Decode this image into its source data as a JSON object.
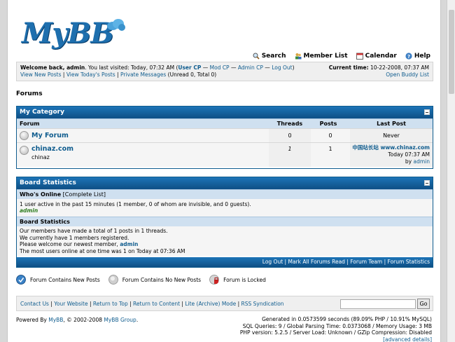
{
  "logo": {
    "text": "MyBB"
  },
  "toplinks": [
    {
      "label": "Search",
      "icon": "search-icon"
    },
    {
      "label": "Member List",
      "icon": "members-icon"
    },
    {
      "label": "Calendar",
      "icon": "calendar-icon"
    },
    {
      "label": "Help",
      "icon": "help-icon"
    }
  ],
  "panel": {
    "welcome_prefix": "Welcome back, admin",
    "last_visit": ". You last visited: Today, 07:32 AM (",
    "user_cp": "User CP",
    "sep1": " — ",
    "mod_cp": "Mod CP",
    "sep2": " — ",
    "admin_cp": "Admin CP",
    "sep3": " — ",
    "logout": "Log Out",
    "close": ")",
    "view_new": "View New Posts",
    "view_today": "View Today's Posts",
    "pm": "Private Messages",
    "pm_counts": "(Unread 0, Total 0)",
    "current_time_label": "Current time:",
    "current_time": "10-22-2008, 07:37 AM",
    "buddy": "Open Buddy List"
  },
  "breadcrumb": "Forums",
  "category": {
    "title": "My Category",
    "headers": {
      "forum": "Forum",
      "threads": "Threads",
      "posts": "Posts",
      "lastpost": "Last Post"
    },
    "forums": [
      {
        "name": "My Forum",
        "desc": "",
        "threads": "0",
        "posts": "0",
        "lastpost_never": "Never"
      },
      {
        "name": "chinaz.com",
        "desc": "chinaz",
        "threads": "1",
        "posts": "1",
        "lastpost_title": "中国站长站  www.chinaz.com",
        "lastpost_time": "Today 07:37 AM",
        "lastpost_by": "by",
        "lastpost_user": "admin"
      }
    ]
  },
  "stats": {
    "title": "Board Statistics",
    "online_label": "Who's Online",
    "complete_list": "[Complete List]",
    "online_text": "1 user active in the past 15 minutes (1 member, 0 of whom are invisible, and 0 guests).",
    "online_user": "admin",
    "board_stats_label": "Board Statistics",
    "line1": "Our members have made a total of 1 posts in 1 threads.",
    "line2": "We currently have 1 members registered.",
    "line3_prefix": "Please welcome our newest member,",
    "line3_user": "admin",
    "line4": "The most users online at one time was 1 on Today at 07:36 AM",
    "links": [
      "Log Out",
      "Mark All Forums Read",
      "Forum Team",
      "Forum Statistics"
    ]
  },
  "legend": [
    {
      "label": "Forum Contains New Posts",
      "icon": "new-posts-icon"
    },
    {
      "label": "Forum Contains No New Posts",
      "icon": "no-new-posts-icon"
    },
    {
      "label": "Forum is Locked",
      "icon": "locked-icon"
    }
  ],
  "footer": {
    "links": [
      "Contact Us",
      "Your Website",
      "Return to Top",
      "Return to Content",
      "Lite (Archive) Mode",
      "RSS Syndication"
    ],
    "go": "Go",
    "powered_prefix": "Powered By",
    "powered_mybb": "MyBB",
    "powered_mid": ", © 2002-2008",
    "powered_group": "MyBB Group",
    "powered_end": ".",
    "debug1": "Generated in 0.0573599 seconds (89.09% PHP / 10.91% MySQL)",
    "debug2": "SQL Queries: 9 / Global Parsing Time: 0.0373068 / Memory Usage: 3 MB",
    "debug3": "PHP version: 5.2.5 / Server Load: Unknown / GZip Compression: Disabled",
    "advanced": "[advanced details]"
  },
  "colors": {
    "header": "#0e4f85",
    "link": "#0f5c8e",
    "category_bg": "#cfe0f0"
  }
}
